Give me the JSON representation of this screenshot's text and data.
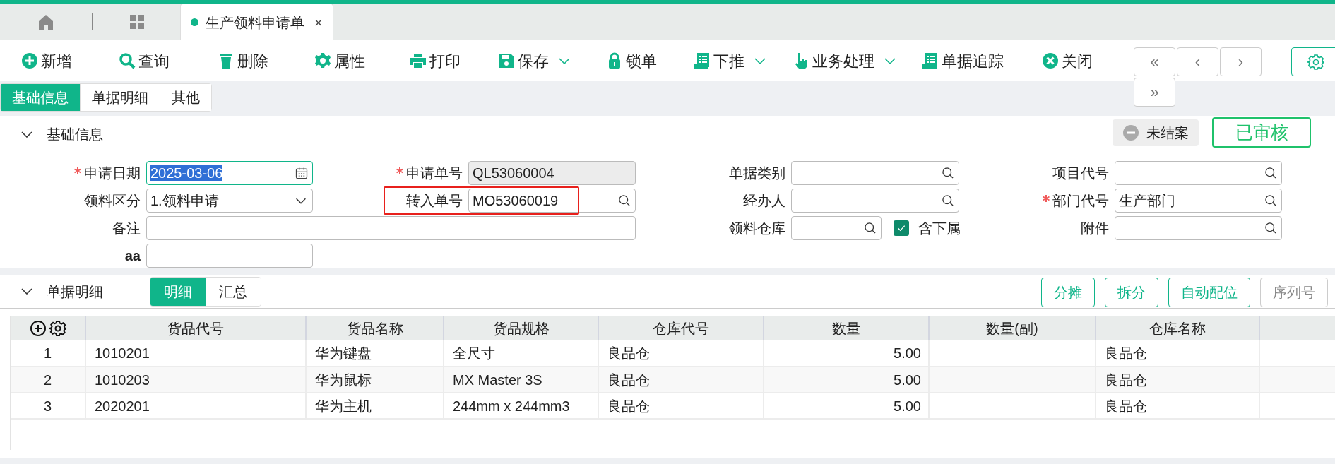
{
  "tabs": [
    {
      "kind": "home",
      "selected": false
    },
    {
      "kind": "apps",
      "selected": false
    },
    {
      "kind": "doc",
      "label": "生产领料申请单",
      "close": "×",
      "selected": true
    }
  ],
  "toolbar": [
    {
      "kind": "plus",
      "label": "新增",
      "dropdown": false
    },
    {
      "kind": "search",
      "label": "查询",
      "dropdown": false
    },
    {
      "kind": "trash",
      "label": "删除",
      "dropdown": false
    },
    {
      "kind": "gear",
      "label": "属性",
      "dropdown": false
    },
    {
      "kind": "printer",
      "label": "打印",
      "dropdown": false
    },
    {
      "kind": "floppy",
      "label": "保存",
      "dropdown": true
    },
    {
      "kind": "lock",
      "label": "锁单",
      "dropdown": false
    },
    {
      "kind": "doc",
      "label": "下推",
      "dropdown": true
    },
    {
      "kind": "hand",
      "label": "业务处理",
      "dropdown": true
    },
    {
      "kind": "doc",
      "label": "单据追踪",
      "dropdown": false
    },
    {
      "kind": "xcircle",
      "label": "关闭",
      "dropdown": false
    }
  ],
  "nav_buttons": [
    "«",
    "‹",
    "›",
    "»"
  ],
  "sub_tabs": [
    {
      "label": "基础信息",
      "selected": true
    },
    {
      "label": "单据明细",
      "selected": false
    },
    {
      "label": "其他",
      "selected": false
    }
  ],
  "basic_section": {
    "title": "基础信息",
    "expanded": true,
    "close_status": "未结案",
    "audit_status": "已审核",
    "fields": [
      {
        "label": "申请日期",
        "required": true,
        "value": "2025-03-06",
        "kind": "date",
        "highlighted": false
      },
      {
        "label": "申请单号",
        "required": true,
        "value": "QL53060004",
        "kind": "readonly",
        "highlighted": false
      },
      {
        "label": "单据类别",
        "required": false,
        "kind": "lookup",
        "highlighted": false
      },
      {
        "label": "项目代号",
        "required": false,
        "kind": "lookup",
        "highlighted": false
      },
      {
        "label": "领料区分",
        "required": false,
        "value": "1.领料申请",
        "kind": "select",
        "highlighted": false
      },
      {
        "label": "转入单号",
        "required": false,
        "value": "MO53060019",
        "kind": "lookup",
        "highlighted": true
      },
      {
        "label": "经办人",
        "required": false,
        "kind": "lookup",
        "highlighted": false
      },
      {
        "label": "部门代号",
        "required": true,
        "value": "生产部门",
        "kind": "lookup",
        "highlighted": false
      },
      {
        "label": "备注",
        "required": false,
        "kind": "wide",
        "highlighted": false
      },
      {
        "label": "领料仓库",
        "required": false,
        "kind": "lookup_check",
        "check_label": "含下属",
        "checked": true,
        "highlighted": false
      },
      {
        "label": "附件",
        "required": false,
        "kind": "lookup",
        "highlighted": false
      },
      {
        "label": "aa",
        "required": false,
        "kind": "text",
        "highlighted": false
      }
    ]
  },
  "detail_section": {
    "title": "单据明细",
    "expanded": true,
    "view_tabs": [
      {
        "label": "明细",
        "selected": true
      },
      {
        "label": "汇总",
        "selected": false
      }
    ],
    "actions": [
      {
        "label": "分摊",
        "disabled": false
      },
      {
        "label": "拆分",
        "disabled": false
      },
      {
        "label": "自动配位",
        "disabled": false
      },
      {
        "label": "序列号",
        "disabled": true
      }
    ],
    "table": {
      "columns": [
        "",
        "货品代号",
        "货品名称",
        "货品规格",
        "仓库代号",
        "数量",
        "数量(副)",
        "仓库名称"
      ],
      "rows": [
        [
          "1",
          "1010201",
          "华为键盘",
          "全尺寸",
          "良品仓",
          "5.00",
          "",
          "良品仓"
        ],
        [
          "2",
          "1010203",
          "华为鼠标",
          "MX Master 3S",
          "良品仓",
          "5.00",
          "",
          "良品仓"
        ],
        [
          "3",
          "2020201",
          "华为主机",
          "244mm x 244mm3",
          "良品仓",
          "5.00",
          "",
          "良品仓"
        ]
      ]
    }
  }
}
